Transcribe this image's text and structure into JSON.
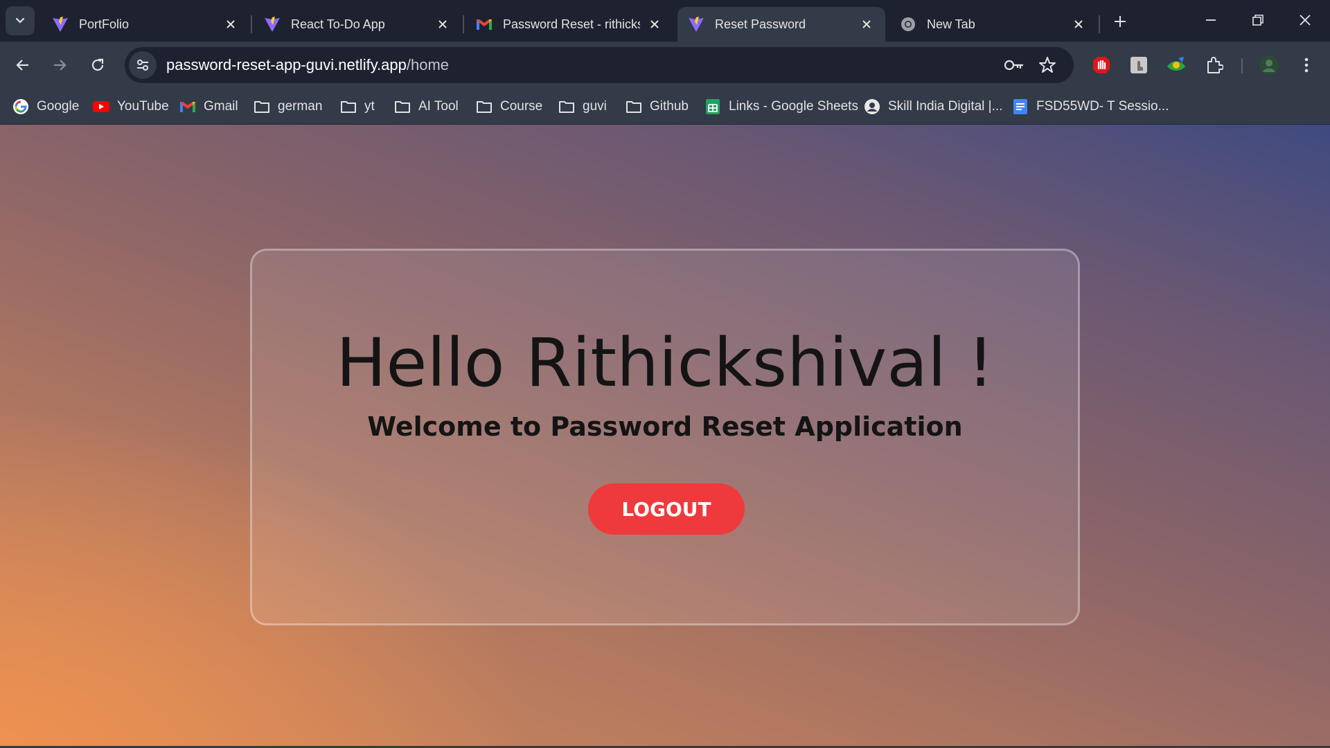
{
  "browser": {
    "tabs": [
      {
        "title": "PortFolio",
        "icon": "vite-icon",
        "active": false
      },
      {
        "title": "React To-Do App",
        "icon": "vite-icon",
        "active": false
      },
      {
        "title": "Password Reset - rithickshivaI",
        "icon": "gmail-icon",
        "active": false
      },
      {
        "title": "Reset Password",
        "icon": "vite-icon",
        "active": true
      },
      {
        "title": "New Tab",
        "icon": "chrome-icon",
        "active": false
      }
    ],
    "address_bar": {
      "url_host": "password-reset-app-guvi.netlify.app",
      "url_path": "/home"
    },
    "bookmarks": [
      {
        "label": "Google",
        "icon": "google-icon"
      },
      {
        "label": "YouTube",
        "icon": "youtube-icon"
      },
      {
        "label": "Gmail",
        "icon": "gmail-icon"
      },
      {
        "label": "german",
        "icon": "folder-icon"
      },
      {
        "label": "yt",
        "icon": "folder-icon"
      },
      {
        "label": "AI Tool",
        "icon": "folder-icon"
      },
      {
        "label": "Course",
        "icon": "folder-icon"
      },
      {
        "label": "guvi",
        "icon": "folder-icon"
      },
      {
        "label": "Github",
        "icon": "folder-icon"
      },
      {
        "label": "Links - Google Sheets",
        "icon": "sheets-icon"
      },
      {
        "label": "Skill India Digital |...",
        "icon": "skill-india-icon"
      },
      {
        "label": "FSD55WD- T Sessio...",
        "icon": "docs-icon"
      }
    ]
  },
  "page": {
    "greeting": "Hello Rithickshival !",
    "welcome": "Welcome to Password Reset Application",
    "logout_label": "LOGOUT"
  },
  "colors": {
    "tabstrip_bg": "#1e2230",
    "toolbar_bg": "#333a48",
    "logout_button": "#ee3a3c",
    "text_dark": "#141414"
  }
}
